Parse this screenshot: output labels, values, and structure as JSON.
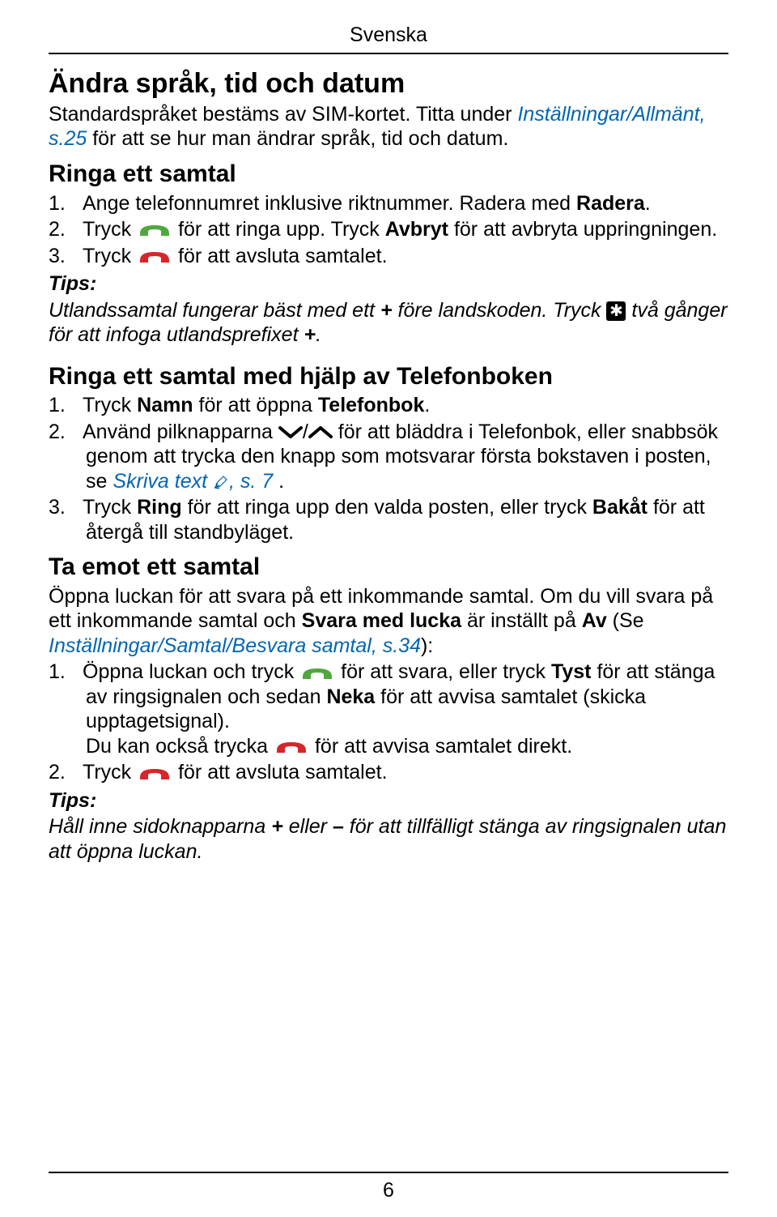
{
  "header": "Svenska",
  "pageNumber": "6",
  "section1": {
    "title": "Ändra språk, tid och datum",
    "p1_a": "Standardspråket bestäms av SIM-kortet. Titta under ",
    "p1_link1": "Inställningar",
    "p1_sep": "/",
    "p1_link2": "Allmänt, s.25",
    "p1_b": " för att se hur man ändrar språk, tid och datum."
  },
  "section2": {
    "title": "Ringa ett samtal",
    "items": [
      {
        "num": "1.",
        "a": "Ange telefonnumret inklusive riktnummer. Radera med ",
        "b1": "Radera",
        "c": "."
      },
      {
        "num": "2.",
        "a": "Tryck ",
        "b": " för att ringa upp. Tryck ",
        "b1": "Avbryt",
        "c": " för att avbryta uppringningen."
      },
      {
        "num": "3.",
        "a": "Tryck ",
        "b": " för att avsluta samtalet."
      }
    ],
    "tipsLabel": "Tips:",
    "tips_a": "Utlandssamtal fungerar bäst med ett ",
    "tips_plus": "+",
    "tips_b": " före landskoden. Tryck ",
    "tips_c": " två gånger för att infoga utlandsprefixet ",
    "tips_plus2": "+",
    "tips_d": "."
  },
  "section3": {
    "title": "Ringa ett samtal med hjälp av Telefonboken",
    "items": [
      {
        "num": "1.",
        "a": "Tryck ",
        "b1": "Namn",
        "b": " för att öppna ",
        "b2": "Telefonbok",
        "c": "."
      },
      {
        "num": "2.",
        "a": "Använd pilknapparna ",
        "sep": "/",
        "b": " för att bläddra i Telefonbok, eller snabbsök genom att trycka den knapp som motsvarar första bokstaven i posten, se ",
        "link": "Skriva text ",
        "link2": ", s. 7",
        "c": " ."
      },
      {
        "num": "3.",
        "a": "Tryck ",
        "b1": "Ring",
        "b": " för att ringa upp den valda posten, eller tryck ",
        "b2": "Bakåt",
        "c": " för att återgå till standbyläget."
      }
    ]
  },
  "section4": {
    "title": "Ta emot ett samtal",
    "p1_a": "Öppna luckan för att svara på ett inkommande samtal. Om du vill svara på ett inkommande samtal och ",
    "p1_b1": "Svara med lucka",
    "p1_b": " är inställt på ",
    "p1_b2": "Av",
    "p1_c": " (Se ",
    "p1_link1": "Inställningar",
    "p1_sep": "/",
    "p1_link2": "Samtal",
    "p1_link3": "Besvara samtal, s.34",
    "p1_d": "):",
    "items": [
      {
        "num": "1.",
        "a": "Öppna luckan och tryck ",
        "b": " för att svara, eller tryck ",
        "b1": "Tyst",
        "c": " för att stänga av ringsignalen och sedan ",
        "b2": "Neka",
        "d": " för att avvisa samtalet (skicka upptagetsignal).",
        "e": "Du kan också trycka ",
        "f": " för att avvisa samtalet direkt."
      },
      {
        "num": "2.",
        "a": "Tryck ",
        "b": " för att avsluta samtalet."
      }
    ],
    "tipsLabel": "Tips:",
    "tips_a": "Håll inne sidoknapparna ",
    "tips_plus": "+",
    "tips_b": " eller ",
    "tips_minus": "–",
    "tips_c": " för att tillfälligt stänga av ringsignalen utan att öppna luckan."
  }
}
